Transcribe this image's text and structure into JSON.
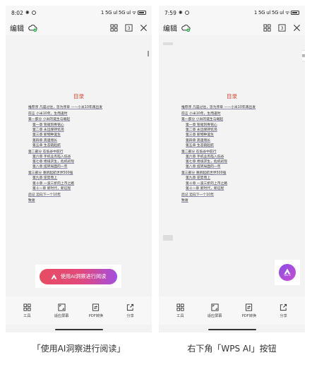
{
  "screens": {
    "left": {
      "status_time": "8:02",
      "status_signal": "1 5G ul 5G ul",
      "toolbar": {
        "edit_label": "编辑"
      },
      "ai_banner_label": "使用AI洞察进行阅读",
      "caption": "「使用AI洞察进行阅读」"
    },
    "right": {
      "status_time": "7:59",
      "status_signal": "1 5G ul 5G ul",
      "toolbar": {
        "edit_label": "编辑"
      },
      "wps_ai_text": "WPS AI",
      "caption": "右下角「WPS AI」按钮"
    }
  },
  "document": {
    "toc_title": "目录",
    "toc_lines": [
      {
        "text": "推荐序 凡是过往，皆为序章 ——小米10年再出发",
        "indent": false,
        "gap": false
      },
      {
        "text": "前言 小米10年，生而逢时",
        "indent": false,
        "gap": true
      },
      {
        "text": "第一部分 小米的诞生与崛起",
        "indent": false,
        "gap": true
      },
      {
        "text": "第一章 管窥刻骨铭心",
        "indent": true,
        "gap": false
      },
      {
        "text": "第二章 永远保持饥渴",
        "indent": true,
        "gap": false
      },
      {
        "text": "第三章 新物种诞生",
        "indent": true,
        "gap": false
      },
      {
        "text": "第四章 高速增长",
        "indent": true,
        "gap": false
      },
      {
        "text": "第五章 生态链起航",
        "indent": true,
        "gap": false
      },
      {
        "text": "第二部分 在低谷中前行",
        "indent": false,
        "gap": true
      },
      {
        "text": "第六章 手机业务陷入低谷",
        "indent": true,
        "gap": false
      },
      {
        "text": "第七章 绝境求生，危机初现",
        "indent": true,
        "gap": false
      },
      {
        "text": "第八章 扭转局面的一年",
        "indent": true,
        "gap": false
      },
      {
        "text": "第三部分 重新起航世界500强",
        "indent": false,
        "gap": true
      },
      {
        "text": "第九章 逆势而上",
        "indent": true,
        "gap": false
      },
      {
        "text": "第十章 一波三折的上市之路",
        "indent": true,
        "gap": false
      },
      {
        "text": "第十一章 新时代，新征程",
        "indent": true,
        "gap": false
      },
      {
        "text": "后记 迈向下一个10年",
        "indent": false,
        "gap": true
      },
      {
        "text": "致谢",
        "indent": false,
        "gap": true
      }
    ]
  },
  "bottom_bar": [
    {
      "label": "工具",
      "icon": "grid-icon"
    },
    {
      "label": "适应屏幕",
      "icon": "fit-screen-icon"
    },
    {
      "label": "PDF转换",
      "icon": "pdf-convert-icon"
    },
    {
      "label": "分享",
      "icon": "share-icon"
    }
  ],
  "colors": {
    "toc_title": "#d9452b",
    "ai_gradient_start": "#e84c62",
    "ai_gradient_end": "#a24fe0",
    "wps_ai_start": "#8a4ee6",
    "wps_ai_end": "#c84dd3"
  }
}
